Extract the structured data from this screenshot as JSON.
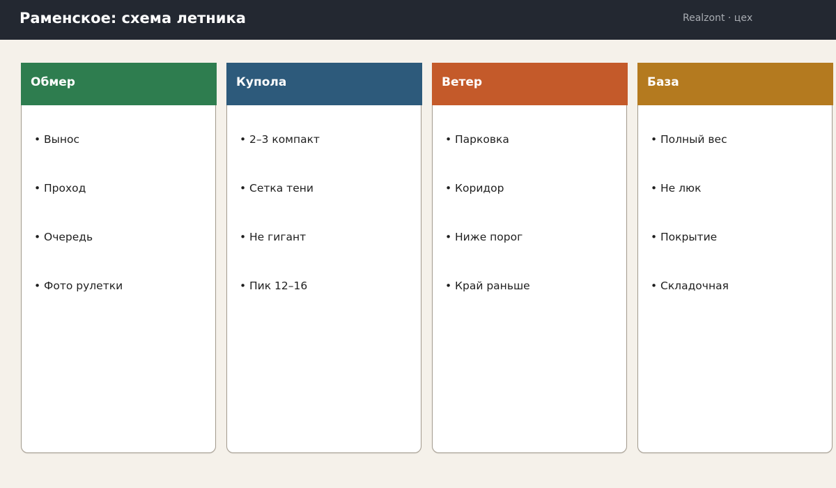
{
  "header": {
    "title": "Раменское: схема летника",
    "brand": "Realzont · цех"
  },
  "colors": {
    "header_bg": "#232831",
    "page_bg": "#f5f1ea"
  },
  "columns": [
    {
      "title": "Обмер",
      "color": "#2e7d4f",
      "items": [
        "Вынос",
        "Проход",
        "Очередь",
        "Фото рулетки"
      ]
    },
    {
      "title": "Купола",
      "color": "#2d5a7b",
      "items": [
        "2–3 компакт",
        "Сетка тени",
        "Не гигант",
        "Пик 12–16"
      ]
    },
    {
      "title": "Ветер",
      "color": "#c45a2a",
      "items": [
        "Парковка",
        "Коридор",
        "Ниже порог",
        "Край раньше"
      ]
    },
    {
      "title": "База",
      "color": "#b47a1f",
      "items": [
        "Полный вес",
        "Не люк",
        "Покрытие",
        "Складочная"
      ]
    }
  ]
}
